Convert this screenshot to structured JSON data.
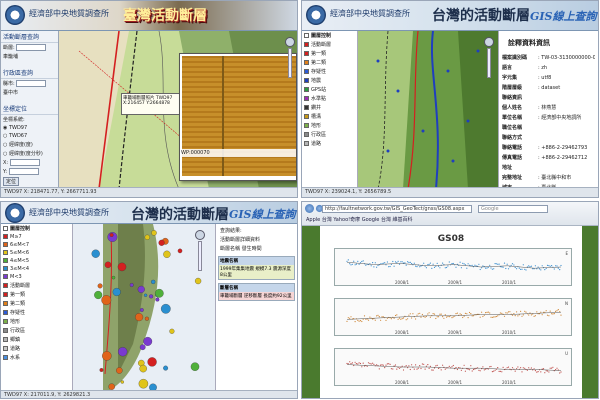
{
  "q1": {
    "org": "經濟部中央地質調查所",
    "title": "臺灣活動斷層",
    "panel": {
      "group1": "活動斷層查詢",
      "fault_label": "斷層:",
      "fault_value": "車籠埔",
      "group2": "行政區查詢",
      "county_label": "縣市:",
      "county_value": "臺中市",
      "group3": "坐標定位",
      "sys_label": "坐標系統:",
      "opt1": "TWD97",
      "opt2": "TWD67",
      "opt3": "經緯度(度)",
      "opt4": "經緯度(度分秒)",
      "x_label": "X:",
      "y_label": "Y:",
      "go": "定位"
    },
    "callout": "車籠埔斷層照片 TWD97 X:216457 Y:2664878",
    "photo_caption": "WP:000070",
    "statusbar": "TWD97 X: 218471.77, Y: 2667711.93"
  },
  "q2": {
    "org": "經濟部中央地質調查所",
    "title": "台灣的活動斷層",
    "sub": "GIS線上查詢",
    "tree": [
      {
        "label": "圖層控制",
        "color": "#ffffff"
      },
      {
        "label": "活動斷層",
        "color": "#d42020"
      },
      {
        "label": "第一類",
        "color": "#d42020"
      },
      {
        "label": "第二類",
        "color": "#e07f1a"
      },
      {
        "label": "存疑性",
        "color": "#2d5bd6"
      },
      {
        "label": "地震",
        "color": "#1f3fbf"
      },
      {
        "label": "GPS站",
        "color": "#2a9e3e"
      },
      {
        "label": "水準點",
        "color": "#9b2ab5"
      },
      {
        "label": "鑽井",
        "color": "#333333"
      },
      {
        "label": "槽溝",
        "color": "#c79a1a"
      },
      {
        "label": "地形",
        "color": "#7bb04a"
      },
      {
        "label": "行政區",
        "color": "#8a8a8a"
      },
      {
        "label": "道路",
        "color": "#b5b5b5"
      }
    ],
    "info_title": "詮釋資料資訊",
    "kv": [
      {
        "k": "檔案識別碼",
        "v": ": TW-03-3130000000-0002"
      },
      {
        "k": "語言",
        "v": ": zh"
      },
      {
        "k": "字元集",
        "v": ": utf8"
      },
      {
        "k": "階層層級",
        "v": ": dataset"
      },
      {
        "k": "聯絡資訊",
        "v": ""
      },
      {
        "k": "個人姓名",
        "v": ": 林燕慧"
      },
      {
        "k": "單位名稱",
        "v": ": 經濟部中央地調所"
      },
      {
        "k": "職位名稱",
        "v": ""
      },
      {
        "k": "聯絡方式",
        "v": ""
      },
      {
        "k": "聯絡電話",
        "v": ": +886-2-29462793"
      },
      {
        "k": "傳真電話",
        "v": ": +886-2-29462712"
      },
      {
        "k": "地址",
        "v": ""
      },
      {
        "k": "完整地址",
        "v": ": 臺北縣中和市"
      },
      {
        "k": "城市",
        "v": ": 臺北縣"
      }
    ],
    "statusbar": "TWD97 X: 239024.1, Y: 2656789.5"
  },
  "q3": {
    "org": "經濟部中央地質調查所",
    "title": "台灣的活動斷層",
    "sub": "GIS線上查詢",
    "tree": [
      {
        "label": "圖層控制",
        "color": "#ffffff"
      },
      {
        "label": "M≥7",
        "color": "#d42020"
      },
      {
        "label": "6≤M<7",
        "color": "#e0641a"
      },
      {
        "label": "5≤M<6",
        "color": "#e0c41a"
      },
      {
        "label": "4≤M<5",
        "color": "#4fb03a"
      },
      {
        "label": "3≤M<4",
        "color": "#2a8fd0"
      },
      {
        "label": "M<3",
        "color": "#7a3ad0"
      },
      {
        "label": "活動斷層",
        "color": "#d42020"
      },
      {
        "label": "第一類",
        "color": "#d42020"
      },
      {
        "label": "第二類",
        "color": "#e07f1a"
      },
      {
        "label": "存疑性",
        "color": "#2d5bd6"
      },
      {
        "label": "地形",
        "color": "#7bb04a"
      },
      {
        "label": "行政區",
        "color": "#8a8a8a"
      },
      {
        "label": "鄉鎮",
        "color": "#b5b5b5"
      },
      {
        "label": "道路",
        "color": "#c8c8c8"
      },
      {
        "label": "水系",
        "color": "#4a8fe0"
      }
    ],
    "info_lines": [
      "查詢結果:",
      "活動斷層詳細資料",
      "斷層名稱 發生時間"
    ],
    "legend_head": "地震名稱",
    "legend_body": "1999年集集地震 規模7.3 震源深度8公里",
    "legend_head2": "斷層名稱",
    "legend_body2": "車籠埔斷層 逆移斷層 長度約92公里",
    "statusbar": "TWD97 X: 217011.9, Y: 2629821.3"
  },
  "q4": {
    "url": "http://faultnetwork.gov.tw/GIS_GeoTect/gnss/GS08.aspx",
    "search_placeholder": "Google",
    "bookmarks": "Apple 台灣  Yahoo!奇摩  Google 台灣  維基百科",
    "chart_title": "GS08",
    "colors": {
      "east": "#3b8fd0",
      "north": "#d08a3b",
      "up": "#c0504d",
      "fit": "#555555"
    }
  },
  "chart_data": {
    "type": "scatter",
    "title": "GS08",
    "series": [
      {
        "name": "E",
        "x": [
          2007.0,
          2007.5,
          2008.0,
          2008.5,
          2009.0,
          2009.5,
          2010.0,
          2010.5,
          2011.0
        ],
        "values": [
          0.2,
          0.1,
          0.15,
          0.05,
          0.1,
          0.0,
          0.05,
          -0.05,
          0.0
        ]
      },
      {
        "name": "N",
        "x": [
          2007.0,
          2007.5,
          2008.0,
          2008.5,
          2009.0,
          2009.5,
          2010.0,
          2010.5,
          2011.0
        ],
        "values": [
          -0.1,
          -0.05,
          0.0,
          0.05,
          0.05,
          0.1,
          0.1,
          0.15,
          0.2
        ]
      },
      {
        "name": "U",
        "x": [
          2007.0,
          2007.5,
          2008.0,
          2008.5,
          2009.0,
          2009.5,
          2010.0,
          2010.5,
          2011.0
        ],
        "values": [
          0.1,
          0.05,
          0.0,
          0.0,
          -0.05,
          -0.05,
          -0.1,
          -0.1,
          -0.15
        ]
      }
    ],
    "xticks": [
      "2008/1",
      "2009/1",
      "2010/1"
    ],
    "xlim": [
      2007.0,
      2011.0
    ],
    "ylim": [
      -0.5,
      0.5
    ],
    "xlabel": "",
    "ylabel": ""
  }
}
